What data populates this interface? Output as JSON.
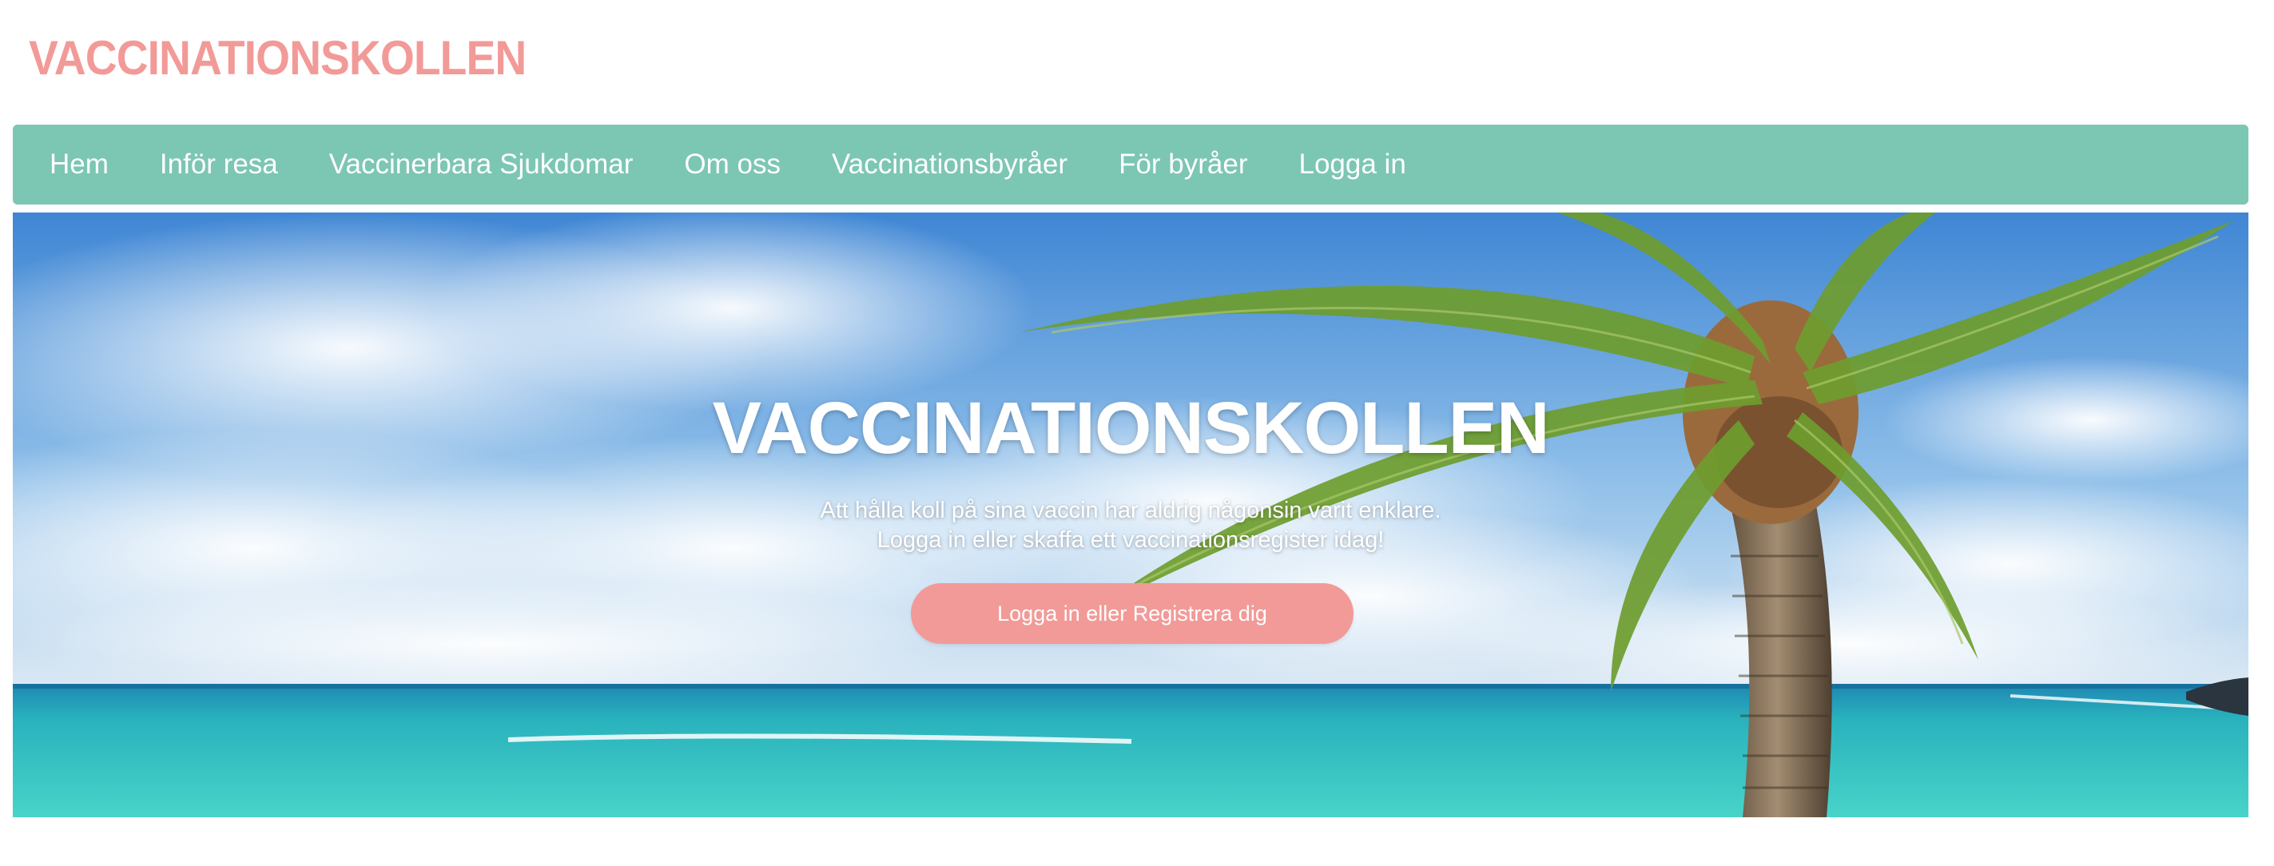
{
  "header": {
    "brand": "VACCINATIONSKOLLEN"
  },
  "nav": {
    "items": [
      {
        "label": "Hem"
      },
      {
        "label": "Inför resa"
      },
      {
        "label": "Vaccinerbara Sjukdomar"
      },
      {
        "label": "Om oss"
      },
      {
        "label": "Vaccinationsbyråer"
      },
      {
        "label": "För byråer"
      },
      {
        "label": "Logga in"
      }
    ]
  },
  "hero": {
    "title": "VACCINATIONSKOLLEN",
    "subtitle_line1": "Att hålla koll på sina vaccin har aldrig någonsin varit enklare.",
    "subtitle_line2": "Logga in eller skaffa ett vaccinationsregister idag!",
    "cta_label": "Logga in eller Registrera dig",
    "image_subject": "tropical beach with palm tree"
  },
  "colors": {
    "brand": "#f29a98",
    "navbar": "#7cc6b4",
    "cta": "#f29a98"
  }
}
